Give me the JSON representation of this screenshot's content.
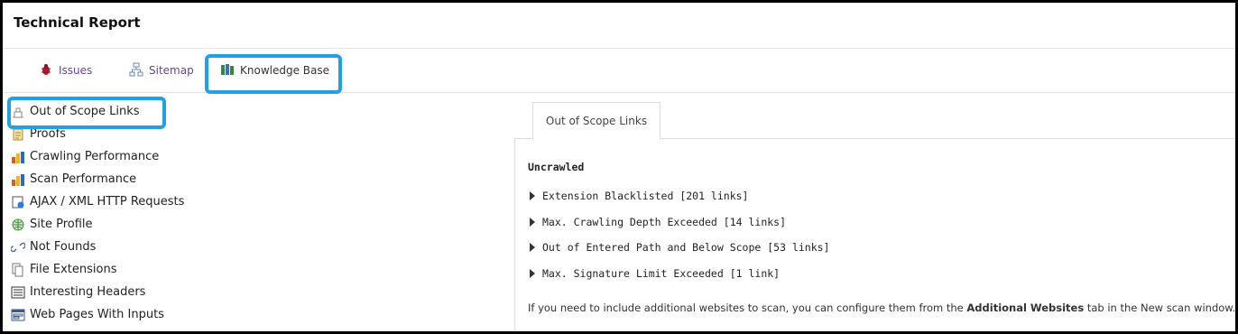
{
  "header": {
    "title": "Technical Report"
  },
  "tabs": [
    {
      "label": "Issues",
      "icon": "bug-icon"
    },
    {
      "label": "Sitemap",
      "icon": "sitemap-icon"
    },
    {
      "label": "Knowledge Base",
      "icon": "books-icon"
    }
  ],
  "knowledge_base": {
    "items": [
      {
        "label": "Out of Scope Links",
        "icon": "scope-icon"
      },
      {
        "label": "Proofs",
        "icon": "proofs-icon"
      },
      {
        "label": "Crawling Performance",
        "icon": "bar-chart-icon"
      },
      {
        "label": "Scan Performance",
        "icon": "bar-chart-icon"
      },
      {
        "label": "AJAX / XML HTTP Requests",
        "icon": "ajax-icon"
      },
      {
        "label": "Site Profile",
        "icon": "globe-icon"
      },
      {
        "label": "Not Founds",
        "icon": "broken-link-icon"
      },
      {
        "label": "File Extensions",
        "icon": "files-icon"
      },
      {
        "label": "Interesting Headers",
        "icon": "headers-icon"
      },
      {
        "label": "Web Pages With Inputs",
        "icon": "form-icon"
      }
    ]
  },
  "panel": {
    "tab_label": "Out of Scope Links",
    "section_title": "Uncrawled",
    "rows": [
      "Extension Blacklisted [201 links]",
      "Max. Crawling Depth Exceeded [14 links]",
      "Out of Entered Path and Below Scope [53 links]",
      "Max. Signature Limit Exceeded [1 link]"
    ],
    "note_pre": "If you need to include additional websites to scan, you can configure them from the ",
    "note_bold": "Additional Websites",
    "note_post": " tab in the New scan window."
  },
  "colors": {
    "highlight": "#1ea1e6",
    "tab_link": "#6a3fa0"
  }
}
